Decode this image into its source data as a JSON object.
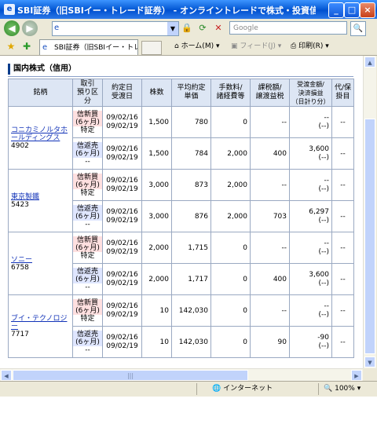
{
  "window": {
    "title": "SBI証券（旧SBIイー・トレード証券） - オンライントレードで株式・投資信託・債券を - Wi...",
    "minimize": "_",
    "maximize": "□",
    "close": "×"
  },
  "addressbar": {
    "url": "",
    "search_placeholder": "Google",
    "search_icon": "🔍"
  },
  "favbar": {
    "tab_label": "SBI証券（旧SBIイー・トレー...",
    "home_label": "ホーム(M)",
    "feed_label": "フィード(J)",
    "print_label": "印刷(R)"
  },
  "page": {
    "section_title": "国内株式（信用）",
    "headers": {
      "name": "銘柄",
      "kbn": "取引\n預り区\n分",
      "dates": "約定日\n受渡日",
      "qty": "株数",
      "avg": "平均約定\n単価",
      "fee": "手数料/\n諸経費等",
      "tax": "課税額/\n譲渡益税",
      "settle": "受渡金額/\n決済損益\n（日計り分）",
      "hold": "代/保\n掛目"
    },
    "stocks": [
      {
        "name": "コニカミノルタホールディングス",
        "code": "4902",
        "rows": [
          {
            "kbn1": "信新買",
            "kbn2": "(6ヶ月)",
            "kbn3": "特定",
            "side": "buy",
            "date1": "09/02/16",
            "date2": "09/02/19",
            "qty": "1,500",
            "avg": "780",
            "fee": "0",
            "tax": "--",
            "settle1": "--",
            "settle2": "(--)",
            "hold": "--"
          },
          {
            "kbn1": "信返売",
            "kbn2": "(6ヶ月)",
            "kbn3": "--",
            "side": "sell",
            "date1": "09/02/16",
            "date2": "09/02/19",
            "qty": "1,500",
            "avg": "784",
            "fee": "2,000",
            "tax": "400",
            "settle1": "3,600",
            "settle2": "(--)",
            "hold": "--"
          }
        ]
      },
      {
        "name": "東京製鐵",
        "code": "5423",
        "rows": [
          {
            "kbn1": "信新買",
            "kbn2": "(6ヶ月)",
            "kbn3": "特定",
            "side": "buy",
            "date1": "09/02/16",
            "date2": "09/02/19",
            "qty": "3,000",
            "avg": "873",
            "fee": "2,000",
            "tax": "--",
            "settle1": "--",
            "settle2": "(--)",
            "hold": "--"
          },
          {
            "kbn1": "信返売",
            "kbn2": "(6ヶ月)",
            "kbn3": "--",
            "side": "sell",
            "date1": "09/02/16",
            "date2": "09/02/19",
            "qty": "3,000",
            "avg": "876",
            "fee": "2,000",
            "tax": "703",
            "settle1": "6,297",
            "settle2": "(--)",
            "hold": "--"
          }
        ]
      },
      {
        "name": "ソニー",
        "code": "6758",
        "rows": [
          {
            "kbn1": "信新買",
            "kbn2": "(6ヶ月)",
            "kbn3": "特定",
            "side": "buy",
            "date1": "09/02/16",
            "date2": "09/02/19",
            "qty": "2,000",
            "avg": "1,715",
            "fee": "0",
            "tax": "--",
            "settle1": "--",
            "settle2": "(--)",
            "hold": "--"
          },
          {
            "kbn1": "信返売",
            "kbn2": "(6ヶ月)",
            "kbn3": "--",
            "side": "sell",
            "date1": "09/02/16",
            "date2": "09/02/19",
            "qty": "2,000",
            "avg": "1,717",
            "fee": "0",
            "tax": "400",
            "settle1": "3,600",
            "settle2": "(--)",
            "hold": "--"
          }
        ]
      },
      {
        "name": "ブイ・テクノロジー",
        "code": "7717",
        "rows": [
          {
            "kbn1": "信新買",
            "kbn2": "(6ヶ月)",
            "kbn3": "特定",
            "side": "buy",
            "date1": "09/02/16",
            "date2": "09/02/19",
            "qty": "10",
            "avg": "142,030",
            "fee": "0",
            "tax": "--",
            "settle1": "--",
            "settle2": "(--)",
            "hold": "--"
          },
          {
            "kbn1": "信返売",
            "kbn2": "(6ヶ月)",
            "kbn3": "--",
            "side": "sell",
            "date1": "09/02/16",
            "date2": "09/02/19",
            "qty": "10",
            "avg": "142,030",
            "fee": "0",
            "tax": "90",
            "settle1": "-90",
            "settle2": "(--)",
            "hold": "--"
          }
        ]
      }
    ]
  },
  "statusbar": {
    "zone": "インターネット",
    "zoom": "100%"
  },
  "colors": {
    "title_blue": "#0a5fd8",
    "header_bg": "#dde6f4",
    "buy_bg": "#ffe0e0",
    "sell_bg": "#dfe6ff",
    "link": "#1233b8"
  }
}
